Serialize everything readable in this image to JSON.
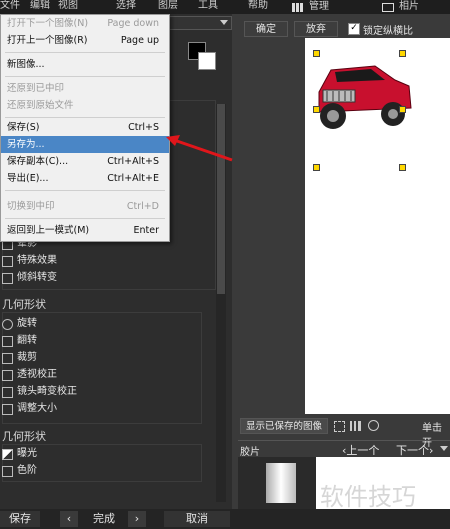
{
  "menubar": {
    "items": [
      "文件",
      "编辑",
      "视图",
      "选择",
      "图层",
      "工具",
      "帮助",
      "管理",
      "相片"
    ]
  },
  "file_menu": {
    "items": [
      {
        "label": "打开下一个图像(N)",
        "shortcut": "Page down",
        "disabled": true
      },
      {
        "label": "打开上一个图像(R)",
        "shortcut": "Page up",
        "disabled": false
      },
      {
        "label": "新图像...",
        "shortcut": "",
        "disabled": false
      },
      {
        "label": "还原到已中印",
        "shortcut": "",
        "disabled": true
      },
      {
        "label": "还原到原始文件",
        "shortcut": "",
        "disabled": true
      },
      {
        "label": "保存(S)",
        "shortcut": "Ctrl+S",
        "disabled": false
      },
      {
        "label": "另存为...",
        "shortcut": "",
        "disabled": false,
        "highlighted": true
      },
      {
        "label": "保存副本(C)...",
        "shortcut": "Ctrl+Alt+S",
        "disabled": false
      },
      {
        "label": "导出(E)...",
        "shortcut": "Ctrl+Alt+E",
        "disabled": false
      },
      {
        "label": "切换到中印",
        "shortcut": "Ctrl+D",
        "disabled": true
      },
      {
        "label": "返回到上一模式(M)",
        "shortcut": "Enter",
        "disabled": false
      }
    ]
  },
  "tools": {
    "partial": [
      "晕影",
      "特殊效果",
      "倾斜转变"
    ],
    "section1_title": "几何形状",
    "section1_items": [
      "旋转",
      "翻转",
      "裁剪",
      "透视校正",
      "镜头畸变校正",
      "调整大小"
    ],
    "section2_title": "几何形状",
    "section2_items": [
      "曝光",
      "色阶"
    ]
  },
  "crop_toolbar": {
    "ok": "确定",
    "discard": "放弃",
    "lock_ratio": "锁定纵横比"
  },
  "right_panel": {
    "show_saved": "显示已保存的图像",
    "single_click": "单击开",
    "filmstrip": "胶片",
    "prev": "上一个",
    "next": "下一个"
  },
  "watermark": "软件技巧",
  "bottom": {
    "save": "保存",
    "done": "完成",
    "cancel": "取消"
  }
}
